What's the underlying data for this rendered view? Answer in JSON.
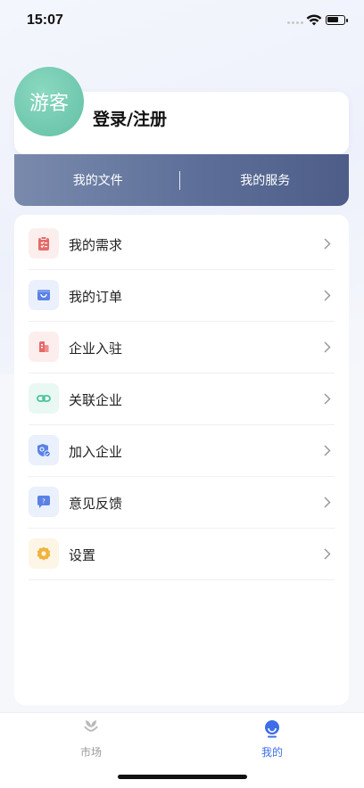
{
  "status_bar": {
    "time": "15:07"
  },
  "profile": {
    "avatar_text": "游客",
    "login_label": "登录/注册"
  },
  "banner": {
    "files_label": "我的文件",
    "services_label": "我的服务"
  },
  "menu": {
    "items": [
      {
        "label": "我的需求",
        "icon": "clipboard-icon",
        "icon_color": "#e46a67",
        "bg": "#fdeeee"
      },
      {
        "label": "我的订单",
        "icon": "shopping-bag-icon",
        "icon_color": "#5a82e6",
        "bg": "#ebf0fd"
      },
      {
        "label": "企业入驻",
        "icon": "building-icon",
        "icon_color": "#e46a67",
        "bg": "#fdeeee"
      },
      {
        "label": "关联企业",
        "icon": "link-icon",
        "icon_color": "#4cc39a",
        "bg": "#e9f8f2"
      },
      {
        "label": "加入企业",
        "icon": "shield-check-icon",
        "icon_color": "#5a82e6",
        "bg": "#ebf0fd"
      },
      {
        "label": "意见反馈",
        "icon": "feedback-icon",
        "icon_color": "#5a82e6",
        "bg": "#ebf0fd"
      },
      {
        "label": "设置",
        "icon": "gear-icon",
        "icon_color": "#f0b33e",
        "bg": "#fdf5e6"
      }
    ]
  },
  "tabbar": {
    "market_label": "市场",
    "mine_label": "我的",
    "active_color": "#3d6ee8",
    "inactive_color": "#9a9a9a"
  }
}
